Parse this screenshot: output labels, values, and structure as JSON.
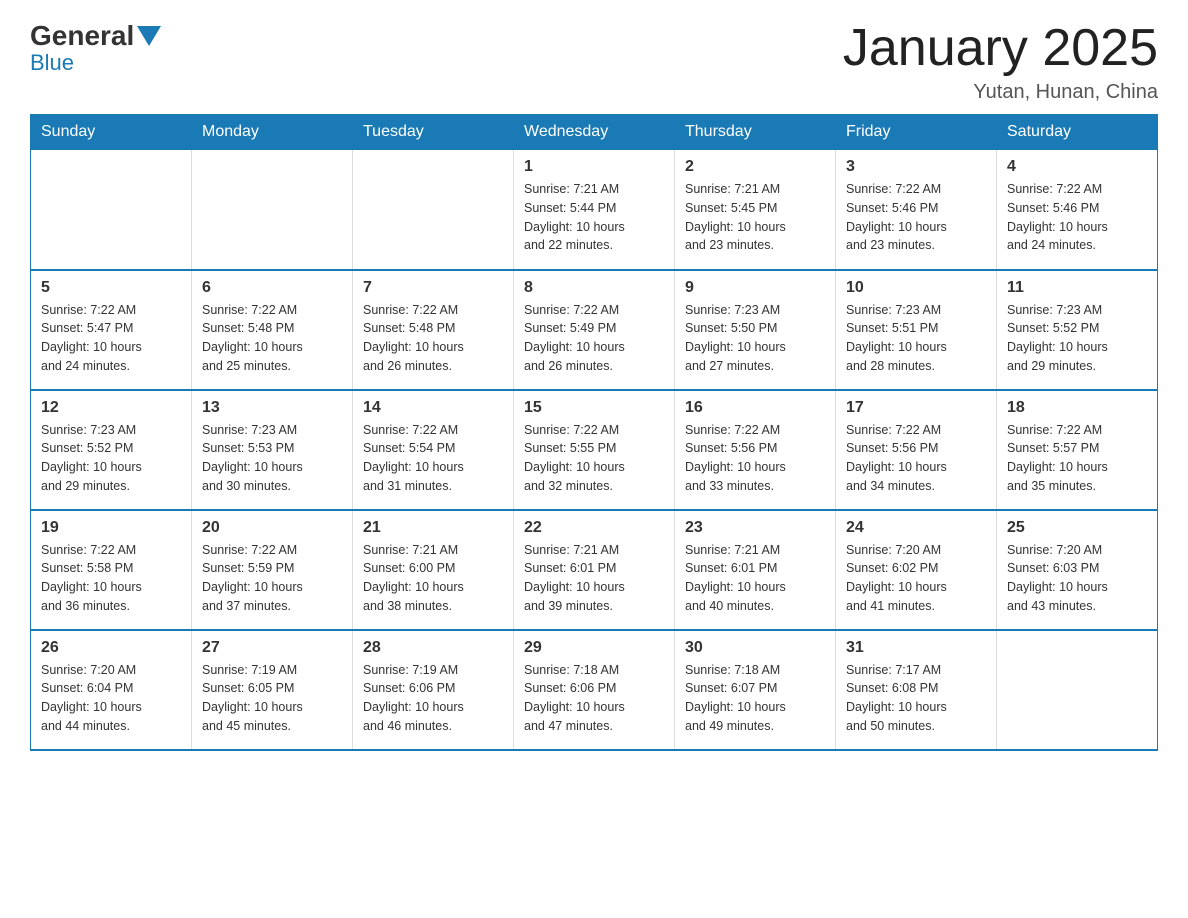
{
  "logo": {
    "general": "General",
    "blue": "Blue"
  },
  "title": "January 2025",
  "location": "Yutan, Hunan, China",
  "days_of_week": [
    "Sunday",
    "Monday",
    "Tuesday",
    "Wednesday",
    "Thursday",
    "Friday",
    "Saturday"
  ],
  "weeks": [
    [
      {
        "day": "",
        "info": ""
      },
      {
        "day": "",
        "info": ""
      },
      {
        "day": "",
        "info": ""
      },
      {
        "day": "1",
        "info": "Sunrise: 7:21 AM\nSunset: 5:44 PM\nDaylight: 10 hours\nand 22 minutes."
      },
      {
        "day": "2",
        "info": "Sunrise: 7:21 AM\nSunset: 5:45 PM\nDaylight: 10 hours\nand 23 minutes."
      },
      {
        "day": "3",
        "info": "Sunrise: 7:22 AM\nSunset: 5:46 PM\nDaylight: 10 hours\nand 23 minutes."
      },
      {
        "day": "4",
        "info": "Sunrise: 7:22 AM\nSunset: 5:46 PM\nDaylight: 10 hours\nand 24 minutes."
      }
    ],
    [
      {
        "day": "5",
        "info": "Sunrise: 7:22 AM\nSunset: 5:47 PM\nDaylight: 10 hours\nand 24 minutes."
      },
      {
        "day": "6",
        "info": "Sunrise: 7:22 AM\nSunset: 5:48 PM\nDaylight: 10 hours\nand 25 minutes."
      },
      {
        "day": "7",
        "info": "Sunrise: 7:22 AM\nSunset: 5:48 PM\nDaylight: 10 hours\nand 26 minutes."
      },
      {
        "day": "8",
        "info": "Sunrise: 7:22 AM\nSunset: 5:49 PM\nDaylight: 10 hours\nand 26 minutes."
      },
      {
        "day": "9",
        "info": "Sunrise: 7:23 AM\nSunset: 5:50 PM\nDaylight: 10 hours\nand 27 minutes."
      },
      {
        "day": "10",
        "info": "Sunrise: 7:23 AM\nSunset: 5:51 PM\nDaylight: 10 hours\nand 28 minutes."
      },
      {
        "day": "11",
        "info": "Sunrise: 7:23 AM\nSunset: 5:52 PM\nDaylight: 10 hours\nand 29 minutes."
      }
    ],
    [
      {
        "day": "12",
        "info": "Sunrise: 7:23 AM\nSunset: 5:52 PM\nDaylight: 10 hours\nand 29 minutes."
      },
      {
        "day": "13",
        "info": "Sunrise: 7:23 AM\nSunset: 5:53 PM\nDaylight: 10 hours\nand 30 minutes."
      },
      {
        "day": "14",
        "info": "Sunrise: 7:22 AM\nSunset: 5:54 PM\nDaylight: 10 hours\nand 31 minutes."
      },
      {
        "day": "15",
        "info": "Sunrise: 7:22 AM\nSunset: 5:55 PM\nDaylight: 10 hours\nand 32 minutes."
      },
      {
        "day": "16",
        "info": "Sunrise: 7:22 AM\nSunset: 5:56 PM\nDaylight: 10 hours\nand 33 minutes."
      },
      {
        "day": "17",
        "info": "Sunrise: 7:22 AM\nSunset: 5:56 PM\nDaylight: 10 hours\nand 34 minutes."
      },
      {
        "day": "18",
        "info": "Sunrise: 7:22 AM\nSunset: 5:57 PM\nDaylight: 10 hours\nand 35 minutes."
      }
    ],
    [
      {
        "day": "19",
        "info": "Sunrise: 7:22 AM\nSunset: 5:58 PM\nDaylight: 10 hours\nand 36 minutes."
      },
      {
        "day": "20",
        "info": "Sunrise: 7:22 AM\nSunset: 5:59 PM\nDaylight: 10 hours\nand 37 minutes."
      },
      {
        "day": "21",
        "info": "Sunrise: 7:21 AM\nSunset: 6:00 PM\nDaylight: 10 hours\nand 38 minutes."
      },
      {
        "day": "22",
        "info": "Sunrise: 7:21 AM\nSunset: 6:01 PM\nDaylight: 10 hours\nand 39 minutes."
      },
      {
        "day": "23",
        "info": "Sunrise: 7:21 AM\nSunset: 6:01 PM\nDaylight: 10 hours\nand 40 minutes."
      },
      {
        "day": "24",
        "info": "Sunrise: 7:20 AM\nSunset: 6:02 PM\nDaylight: 10 hours\nand 41 minutes."
      },
      {
        "day": "25",
        "info": "Sunrise: 7:20 AM\nSunset: 6:03 PM\nDaylight: 10 hours\nand 43 minutes."
      }
    ],
    [
      {
        "day": "26",
        "info": "Sunrise: 7:20 AM\nSunset: 6:04 PM\nDaylight: 10 hours\nand 44 minutes."
      },
      {
        "day": "27",
        "info": "Sunrise: 7:19 AM\nSunset: 6:05 PM\nDaylight: 10 hours\nand 45 minutes."
      },
      {
        "day": "28",
        "info": "Sunrise: 7:19 AM\nSunset: 6:06 PM\nDaylight: 10 hours\nand 46 minutes."
      },
      {
        "day": "29",
        "info": "Sunrise: 7:18 AM\nSunset: 6:06 PM\nDaylight: 10 hours\nand 47 minutes."
      },
      {
        "day": "30",
        "info": "Sunrise: 7:18 AM\nSunset: 6:07 PM\nDaylight: 10 hours\nand 49 minutes."
      },
      {
        "day": "31",
        "info": "Sunrise: 7:17 AM\nSunset: 6:08 PM\nDaylight: 10 hours\nand 50 minutes."
      },
      {
        "day": "",
        "info": ""
      }
    ]
  ]
}
